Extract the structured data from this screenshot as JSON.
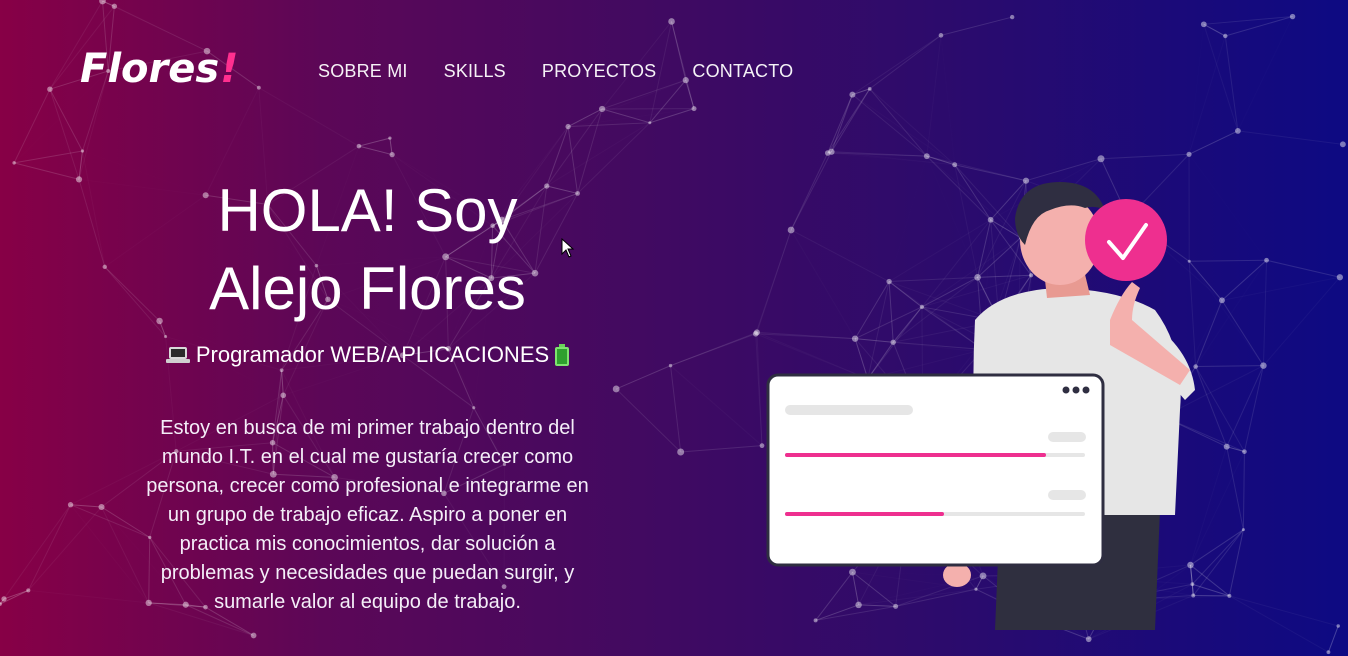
{
  "header": {
    "logo_text": "Flores",
    "logo_mark": "!",
    "nav": [
      {
        "label": "SOBRE MI"
      },
      {
        "label": "SKILLS"
      },
      {
        "label": "PROYECTOS"
      },
      {
        "label": "CONTACTO"
      }
    ]
  },
  "hero": {
    "title_line1": "HOLA! Soy",
    "title_line2": "Alejo Flores",
    "subtitle": "Programador WEB/APLICACIONES",
    "subtitle_icons": [
      "laptop-icon",
      "battery-icon"
    ],
    "description": "Estoy en busca de mi primer trabajo dentro del mundo I.T. en el cual me gustaría crecer como persona, crecer como profesional e integrarme en un grupo de trabajo eficaz. Aspiro a poner en practica mis conocimientos, dar solución a problemas y necesidades que puedan surgir, y sumarle valor al equipo de trabajo."
  },
  "illustration": {
    "progress": [
      0.87,
      0.53
    ],
    "accent": "#ee2f8f",
    "check_icon": "checkmark-icon"
  },
  "colors": {
    "accent": "#ff2f8f",
    "gradient_left": "#870046",
    "gradient_right": "#0d0a83"
  }
}
